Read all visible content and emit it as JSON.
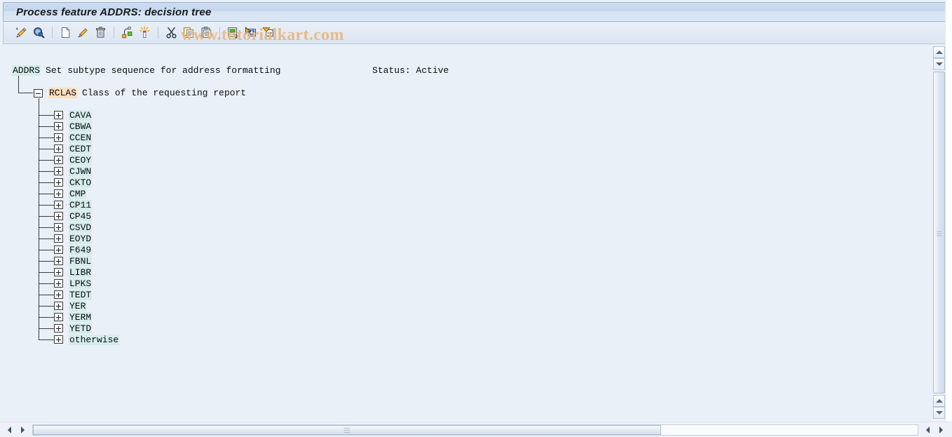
{
  "window": {
    "title": "Process feature ADDRS: decision tree"
  },
  "toolbar": {
    "buttons": [
      {
        "name": "change-icon",
        "label": "Change",
        "glyph": "pencil-ruler"
      },
      {
        "name": "display-icon",
        "label": "Display",
        "glyph": "magnifier"
      },
      {
        "name": "create-icon",
        "label": "Create",
        "glyph": "new-page"
      },
      {
        "name": "edit-icon",
        "label": "Change node",
        "glyph": "pencil"
      },
      {
        "name": "delete-icon",
        "label": "Delete",
        "glyph": "trash"
      },
      {
        "name": "structure-icon",
        "label": "Structure",
        "glyph": "nodes"
      },
      {
        "name": "generate-icon",
        "label": "Generate",
        "glyph": "wand"
      },
      {
        "name": "cut-icon",
        "label": "Cut",
        "glyph": "scissors"
      },
      {
        "name": "copy-icon",
        "label": "Copy",
        "glyph": "copy"
      },
      {
        "name": "paste-icon",
        "label": "Paste",
        "glyph": "clipboard"
      },
      {
        "name": "insert-icon",
        "label": "Insert",
        "glyph": "insert"
      },
      {
        "name": "expand-all-icon",
        "label": "Expand subtree",
        "glyph": "expand"
      },
      {
        "name": "collapse-all-icon",
        "label": "Collapse subtree",
        "glyph": "collapse"
      }
    ]
  },
  "watermark": {
    "text": "www.tutorialkart.com",
    "color": "#e9b784"
  },
  "tree": {
    "root": {
      "code": "ADDRS",
      "description": "Set subtype sequence for address formatting"
    },
    "status": "Status: Active",
    "level1": {
      "code": "RCLAS",
      "description": "Class of the requesting report",
      "state": "expanded"
    },
    "children": [
      {
        "label": "CAVA",
        "state": "collapsed"
      },
      {
        "label": "CBWA",
        "state": "collapsed"
      },
      {
        "label": "CCEN",
        "state": "collapsed"
      },
      {
        "label": "CEDT",
        "state": "collapsed"
      },
      {
        "label": "CEOY",
        "state": "collapsed"
      },
      {
        "label": "CJWN",
        "state": "collapsed"
      },
      {
        "label": "CKTO",
        "state": "collapsed"
      },
      {
        "label": "CMP",
        "state": "collapsed"
      },
      {
        "label": "CP11",
        "state": "collapsed"
      },
      {
        "label": "CP45",
        "state": "collapsed"
      },
      {
        "label": "CSVD",
        "state": "collapsed"
      },
      {
        "label": "EOYD",
        "state": "collapsed"
      },
      {
        "label": "F649",
        "state": "collapsed"
      },
      {
        "label": "FBNL",
        "state": "collapsed"
      },
      {
        "label": "LIBR",
        "state": "collapsed"
      },
      {
        "label": "LPKS",
        "state": "collapsed"
      },
      {
        "label": "TEDT",
        "state": "collapsed"
      },
      {
        "label": "YER",
        "state": "collapsed"
      },
      {
        "label": "YERM",
        "state": "collapsed"
      },
      {
        "label": "YETD",
        "state": "collapsed"
      },
      {
        "label": "otherwise",
        "state": "collapsed"
      }
    ]
  },
  "colors": {
    "code_highlight": "#d5ecec",
    "node_highlight": "#fadfc0",
    "background": "#eaf0f7",
    "titlebar": "#c3d6ec"
  },
  "scrollbars": {
    "vertical": {
      "up": "scroll-up",
      "down": "scroll-down"
    },
    "horizontal": {
      "left": "scroll-left",
      "right": "scroll-right"
    }
  }
}
